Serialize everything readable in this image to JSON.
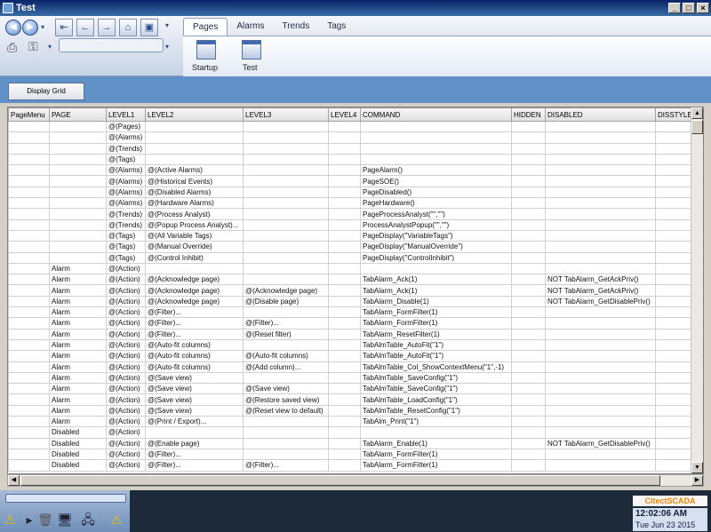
{
  "window": {
    "title": "Test",
    "min": "_",
    "max": "□",
    "close": "×"
  },
  "tabs": [
    {
      "label": "Pages",
      "active": true
    },
    {
      "label": "Alarms"
    },
    {
      "label": "Trends"
    },
    {
      "label": "Tags"
    }
  ],
  "pages": [
    {
      "label": "Startup"
    },
    {
      "label": "Test"
    }
  ],
  "display_grid_label": "Display Grid",
  "grid": {
    "columns": [
      "PageMenu",
      "PAGE",
      "LEVEL1",
      "LEVEL2",
      "LEVEL3",
      "LEVEL4",
      "COMMAND",
      "HIDDEN",
      "DISABLED",
      "DISSTYLE"
    ],
    "rows": [
      [
        "",
        "",
        "@(Pages)",
        "",
        "",
        "",
        "",
        "",
        "",
        ""
      ],
      [
        "",
        "",
        "@(Alarms)",
        "",
        "",
        "",
        "",
        "",
        "",
        ""
      ],
      [
        "",
        "",
        "@(Trends)",
        "",
        "",
        "",
        "",
        "",
        "",
        ""
      ],
      [
        "",
        "",
        "@(Tags)",
        "",
        "",
        "",
        "",
        "",
        "",
        ""
      ],
      [
        "",
        "",
        "@(Alarms)",
        "@(Active Alarms)",
        "",
        "",
        "PageAlarm()",
        "",
        "",
        ""
      ],
      [
        "",
        "",
        "@(Alarms)",
        "@(Historical Events)",
        "",
        "",
        "PageSOE()",
        "",
        "",
        ""
      ],
      [
        "",
        "",
        "@(Alarms)",
        "@(Disabled Alarms)",
        "",
        "",
        "PageDisabled()",
        "",
        "",
        ""
      ],
      [
        "",
        "",
        "@(Alarms)",
        "@(Hardware Alarms)",
        "",
        "",
        "PageHardware()",
        "",
        "",
        ""
      ],
      [
        "",
        "",
        "@(Trends)",
        "@(Process Analyst)",
        "",
        "",
        "PageProcessAnalyst(\"\",\"\")",
        "",
        "",
        ""
      ],
      [
        "",
        "",
        "@(Trends)",
        "@(Popup Process Analyst)...",
        "",
        "",
        "ProcessAnalystPopup(\"\",\"\")",
        "",
        "",
        ""
      ],
      [
        "",
        "",
        "@(Tags)",
        "@(All Variable Tags)",
        "",
        "",
        "PageDisplay(\"VariableTags\")",
        "",
        "",
        ""
      ],
      [
        "",
        "",
        "@(Tags)",
        "@(Manual Override)",
        "",
        "",
        "PageDisplay(\"ManualOverride\")",
        "",
        "",
        ""
      ],
      [
        "",
        "",
        "@(Tags)",
        "@(Control Inhibit)",
        "",
        "",
        "PageDisplay(\"ControlInhibit\")",
        "",
        "",
        ""
      ],
      [
        "",
        "Alarm",
        "@(Action)",
        "",
        "",
        "",
        "",
        "",
        "",
        ""
      ],
      [
        "",
        "Alarm",
        "@(Action)",
        "@(Acknowledge page)",
        "",
        "",
        "TabAlarm_Ack(1)",
        "",
        "NOT TabAlarm_GetAckPriv()",
        ""
      ],
      [
        "",
        "Alarm",
        "@(Action)",
        "@(Acknowledge page)",
        "@(Acknowledge page)",
        "",
        "TabAlarm_Ack(1)",
        "",
        "NOT TabAlarm_GetAckPriv()",
        ""
      ],
      [
        "",
        "Alarm",
        "@(Action)",
        "@(Acknowledge page)",
        "@(Disable page)",
        "",
        "TabAlarm_Disable(1)",
        "",
        "NOT TabAlarm_GetDisablePriv()",
        ""
      ],
      [
        "",
        "Alarm",
        "@(Action)",
        "@(Filter)...",
        "",
        "",
        "TabAlarm_FormFilter(1)",
        "",
        "",
        ""
      ],
      [
        "",
        "Alarm",
        "@(Action)",
        "@(Filter)...",
        "@(Filter)...",
        "",
        "TabAlarm_FormFilter(1)",
        "",
        "",
        ""
      ],
      [
        "",
        "Alarm",
        "@(Action)",
        "@(Filter)...",
        "@(Reset filter)",
        "",
        "TabAlarm_ResetFilter(1)",
        "",
        "",
        ""
      ],
      [
        "",
        "Alarm",
        "@(Action)",
        "@(Auto-fit columns)",
        "",
        "",
        "TabAlmTable_AutoFit(\"1\")",
        "",
        "",
        ""
      ],
      [
        "",
        "Alarm",
        "@(Action)",
        "@(Auto-fit columns)",
        "@(Auto-fit columns)",
        "",
        "TabAlmTable_AutoFit(\"1\")",
        "",
        "",
        ""
      ],
      [
        "",
        "Alarm",
        "@(Action)",
        "@(Auto-fit columns)",
        "@(Add column)...",
        "",
        "TabAlmTable_Col_ShowContextMenu(\"1\",-1)",
        "",
        "",
        ""
      ],
      [
        "",
        "Alarm",
        "@(Action)",
        "@(Save view)",
        "",
        "",
        "TabAlmTable_SaveConfig(\"1\")",
        "",
        "",
        ""
      ],
      [
        "",
        "Alarm",
        "@(Action)",
        "@(Save view)",
        "@(Save view)",
        "",
        "TabAlmTable_SaveConfig(\"1\")",
        "",
        "",
        ""
      ],
      [
        "",
        "Alarm",
        "@(Action)",
        "@(Save view)",
        "@(Restore saved view)",
        "",
        "TabAlmTable_LoadConfig(\"1\")",
        "",
        "",
        ""
      ],
      [
        "",
        "Alarm",
        "@(Action)",
        "@(Save view)",
        "@(Reset view to default)",
        "",
        "TabAlmTable_ResetConfig(\"1\")",
        "",
        "",
        ""
      ],
      [
        "",
        "Alarm",
        "@(Action)",
        "@(Print / Export)...",
        "",
        "",
        "TabAlm_Print(\"1\")",
        "",
        "",
        ""
      ],
      [
        "",
        "Disabled",
        "@(Action)",
        "",
        "",
        "",
        "",
        "",
        "",
        ""
      ],
      [
        "",
        "Disabled",
        "@(Action)",
        "@(Enable page)",
        "",
        "",
        "TabAlarm_Enable(1)",
        "",
        "NOT TabAlarm_GetDisablePriv()",
        ""
      ],
      [
        "",
        "Disabled",
        "@(Action)",
        "@(Filter)...",
        "",
        "",
        "TabAlarm_FormFilter(1)",
        "",
        "",
        ""
      ],
      [
        "",
        "Disabled",
        "@(Action)",
        "@(Filter)...",
        "@(Filter)...",
        "",
        "TabAlarm_FormFilter(1)",
        "",
        "",
        ""
      ]
    ]
  },
  "status": {
    "brand": "CitectSCADA",
    "time": "12:02:06 AM",
    "date": "Tue Jun 23 2015"
  }
}
